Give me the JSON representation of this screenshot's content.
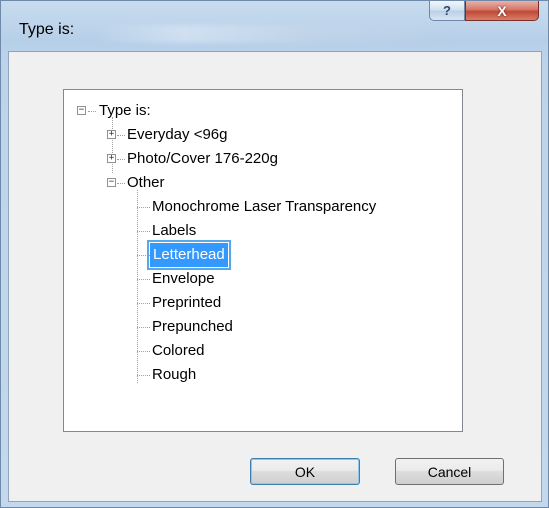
{
  "dialog": {
    "title": "Type is:",
    "help_glyph": "?",
    "close_glyph": "X"
  },
  "tree": {
    "root": {
      "label": "Type is:",
      "expander": "−"
    },
    "items": [
      {
        "label": "Everyday <96g",
        "expander": "+"
      },
      {
        "label": "Photo/Cover 176-220g",
        "expander": "+"
      },
      {
        "label": "Other",
        "expander": "−"
      }
    ],
    "other_children": [
      "Monochrome Laser Transparency",
      "Labels",
      "Letterhead",
      "Envelope",
      "Preprinted",
      "Prepunched",
      "Colored",
      "Rough"
    ],
    "selected": "Letterhead"
  },
  "buttons": {
    "ok_label": "OK",
    "cancel_label": "Cancel"
  }
}
